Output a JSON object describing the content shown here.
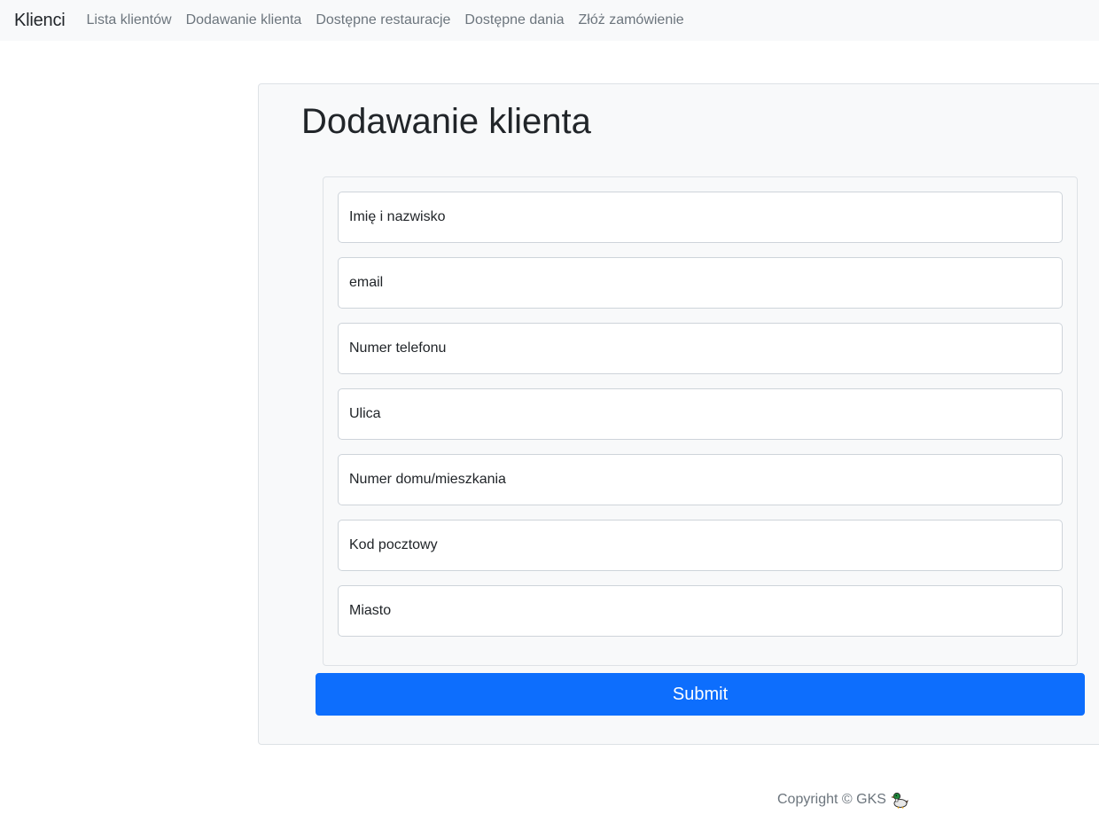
{
  "navbar": {
    "brand": "Klienci",
    "links": [
      "Lista klientów",
      "Dodawanie klienta",
      "Dostępne restauracje",
      "Dostępne dania",
      "Złóż zamówienie"
    ]
  },
  "form": {
    "title": "Dodawanie klienta",
    "fields": [
      {
        "placeholder": "Imię i nazwisko",
        "value": ""
      },
      {
        "placeholder": "email",
        "value": ""
      },
      {
        "placeholder": "Numer telefonu",
        "value": ""
      },
      {
        "placeholder": "Ulica",
        "value": ""
      },
      {
        "placeholder": "Numer domu/mieszkania",
        "value": ""
      },
      {
        "placeholder": "Kod pocztowy",
        "value": ""
      },
      {
        "placeholder": "Miasto",
        "value": ""
      }
    ],
    "submit_label": "Submit"
  },
  "footer": {
    "text": "Copyright © GKS",
    "icon": "duck-icon"
  },
  "colors": {
    "primary": "#0d6efd",
    "navbar_bg": "#f8f9fa",
    "muted_text": "#6c757d"
  }
}
